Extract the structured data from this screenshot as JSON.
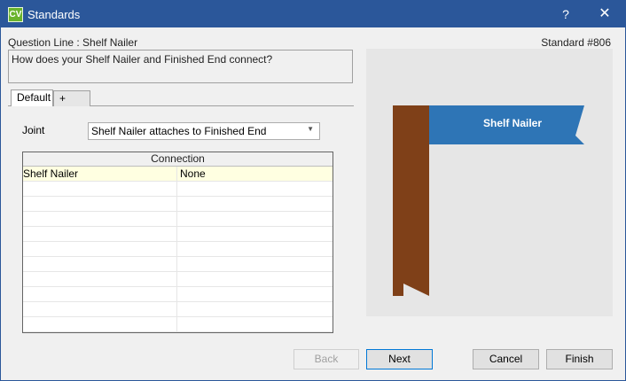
{
  "window": {
    "title": "Standards",
    "app_icon_text": "CV",
    "help_glyph": "?",
    "close_glyph": "✕"
  },
  "header": {
    "question_line_label": "Question Line : Shelf Nailer",
    "standard_label": "Standard #806",
    "question_text": "How does your Shelf Nailer and Finished End connect?"
  },
  "tabs": [
    {
      "label": "Default",
      "active": true
    },
    {
      "label": "+",
      "active": false
    }
  ],
  "joint": {
    "label": "Joint",
    "value": "Shelf Nailer attaches to Finished End"
  },
  "grid": {
    "header": "Connection",
    "rows": [
      {
        "a": "Shelf Nailer",
        "b": "None"
      }
    ]
  },
  "preview": {
    "banner_label": "Shelf Nailer",
    "banner_color": "#2e75b6",
    "end_color": "#7f4018"
  },
  "buttons": {
    "back": "Back",
    "next": "Next",
    "cancel": "Cancel",
    "finish": "Finish"
  }
}
